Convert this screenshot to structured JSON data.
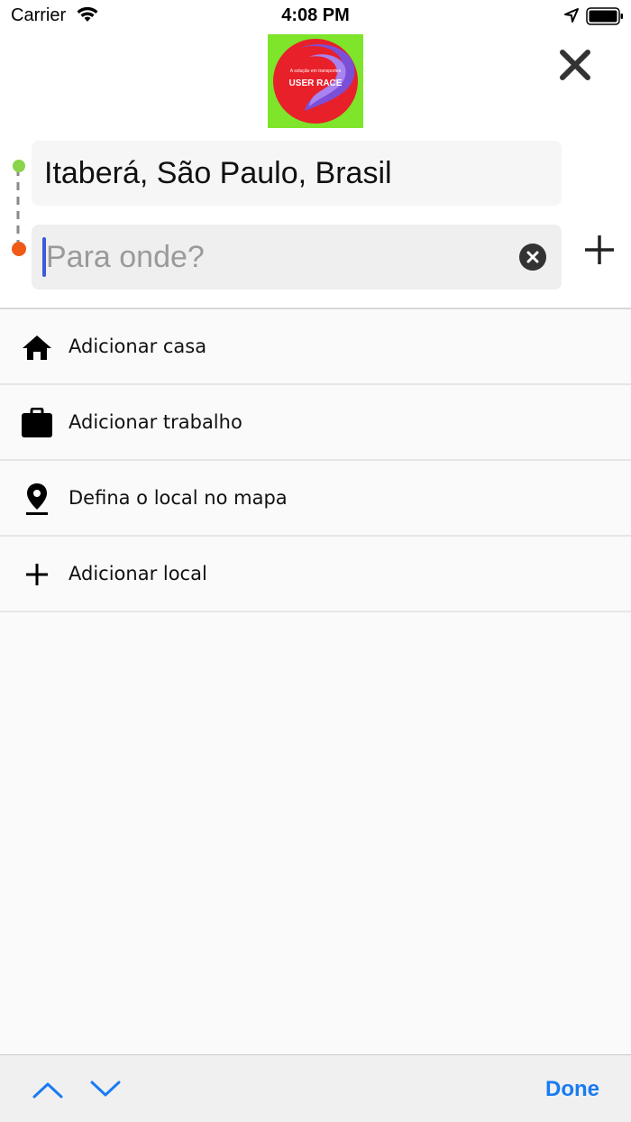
{
  "status_bar": {
    "carrier": "Carrier",
    "time": "4:08 PM",
    "icons": [
      "wifi-icon",
      "location-arrow-icon",
      "battery-icon"
    ]
  },
  "header": {
    "logo": {
      "tagline": "A solução em transportes",
      "brand": "USER RACE",
      "colors": {
        "background": "#7ee52b",
        "circle": "#e8202a",
        "swirl": "#7b4fd6"
      }
    },
    "close_icon": "close-icon",
    "origin": {
      "value": "Itaberá, São Paulo, Brasil",
      "dot_color": "#8bd34a"
    },
    "destination": {
      "value": "",
      "placeholder": "Para onde?",
      "dot_color": "#f05a16"
    },
    "clear_icon": "clear-circle-icon",
    "add_stop_icon": "plus-icon"
  },
  "saved_places": [
    {
      "icon": "home-icon",
      "label": "Adicionar casa"
    },
    {
      "icon": "briefcase-icon",
      "label": "Adicionar trabalho"
    },
    {
      "icon": "map-pin-icon",
      "label": "Defina o local no mapa"
    },
    {
      "icon": "plus-icon",
      "label": "Adicionar local"
    }
  ],
  "accessory_bar": {
    "prev_icon": "chevron-up-icon",
    "next_icon": "chevron-down-icon",
    "done_label": "Done",
    "accent": "#1a7bf2"
  }
}
